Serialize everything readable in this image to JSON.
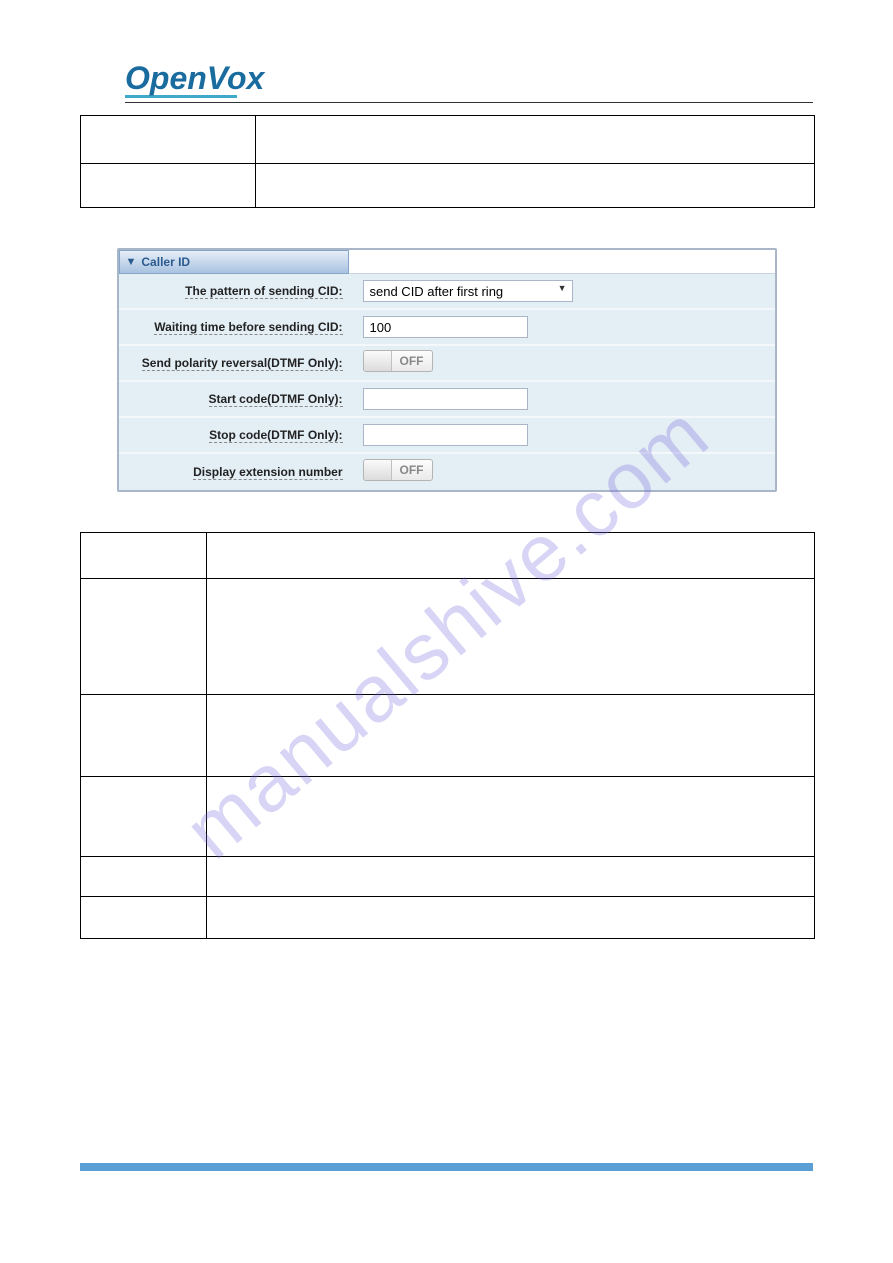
{
  "logo": {
    "open": "Open",
    "vox": "Vox"
  },
  "panel": {
    "title": "Caller ID",
    "rows": {
      "pattern": {
        "label": "The pattern of sending CID:",
        "value": "send CID after first ring"
      },
      "waiting": {
        "label": "Waiting time before sending CID:",
        "value": "100"
      },
      "polarity": {
        "label": "Send polarity reversal(DTMF Only):",
        "state": "OFF"
      },
      "startcode": {
        "label": "Start code(DTMF Only):",
        "value": ""
      },
      "stopcode": {
        "label": "Stop code(DTMF Only):",
        "value": ""
      },
      "displayext": {
        "label": "Display extension number",
        "state": "OFF"
      }
    }
  },
  "watermark": "manualshive.com"
}
